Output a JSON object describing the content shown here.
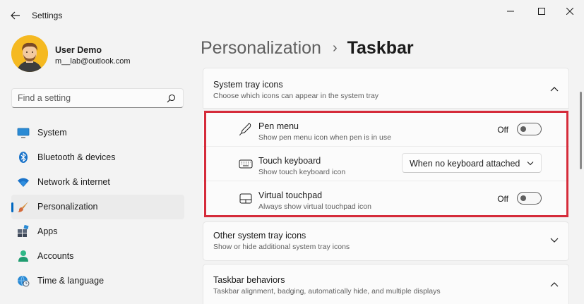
{
  "window": {
    "title": "Settings"
  },
  "profile": {
    "name": "User Demo",
    "email": "m__lab@outlook.com"
  },
  "search": {
    "placeholder": "Find a setting"
  },
  "sidebar": {
    "items": [
      {
        "label": "System",
        "icon": "monitor-icon",
        "active": false
      },
      {
        "label": "Bluetooth & devices",
        "icon": "bluetooth-icon",
        "active": false
      },
      {
        "label": "Network & internet",
        "icon": "wifi-icon",
        "active": false
      },
      {
        "label": "Personalization",
        "icon": "brush-icon",
        "active": true
      },
      {
        "label": "Apps",
        "icon": "apps-icon",
        "active": false
      },
      {
        "label": "Accounts",
        "icon": "person-icon",
        "active": false
      },
      {
        "label": "Time & language",
        "icon": "globe-clock-icon",
        "active": false
      }
    ]
  },
  "breadcrumb": {
    "parent": "Personalization",
    "separator": "›",
    "current": "Taskbar"
  },
  "sections": {
    "system_tray": {
      "title": "System tray icons",
      "subtitle": "Choose which icons can appear in the system tray",
      "expanded": true,
      "rows": {
        "pen": {
          "title": "Pen menu",
          "subtitle": "Show pen menu icon when pen is in use",
          "state": "Off",
          "on": false
        },
        "keyboard": {
          "title": "Touch keyboard",
          "subtitle": "Show touch keyboard icon",
          "selected": "When no keyboard attached"
        },
        "touchpad": {
          "title": "Virtual touchpad",
          "subtitle": "Always show virtual touchpad icon",
          "state": "Off",
          "on": false
        }
      }
    },
    "other_tray": {
      "title": "Other system tray icons",
      "subtitle": "Show or hide additional system tray icons",
      "expanded": false
    },
    "behaviors": {
      "title": "Taskbar behaviors",
      "subtitle": "Taskbar alignment, badging, automatically hide, and multiple displays",
      "expanded": true
    }
  },
  "colors": {
    "accent": "#0067c0",
    "highlight": "#d52b3a"
  }
}
